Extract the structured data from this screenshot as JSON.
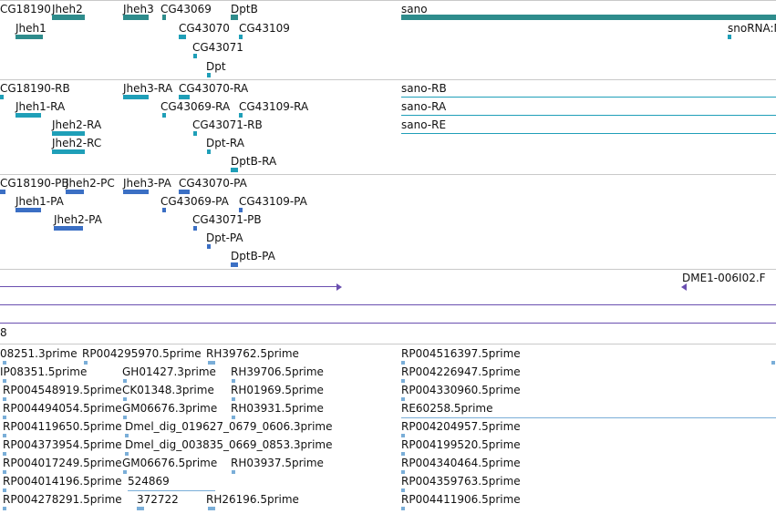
{
  "tracks": {
    "genes": {
      "features": [
        "CG18190",
        "Jheh2",
        "Jheh3",
        "CG43069",
        "DptB",
        "sano",
        "Jheh1",
        "CG43070",
        "CG43109",
        "CG43071",
        "Dpt",
        "snoRNA:M"
      ],
      "color": "#2e8c8c"
    },
    "transcripts": {
      "features": [
        "CG18190-RB",
        "Jheh3-RA",
        "CG43070-RA",
        "sano-RB",
        "Jheh1-RA",
        "CG43069-RA",
        "CG43109-RA",
        "sano-RA",
        "Jheh2-RA",
        "CG43071-RB",
        "sano-RE",
        "Jheh2-RC",
        "Dpt-RA",
        "DptB-RA"
      ],
      "color": "#1f9fb8"
    },
    "proteins": {
      "features": [
        "CG18190-PB",
        "Jheh2-PC",
        "Jheh3-PA",
        "CG43070-PA",
        "Jheh1-PA",
        "CG43069-PA",
        "CG43109-PA",
        "Jheh2-PA",
        "CG43071-PB",
        "Dpt-PA",
        "DptB-PA"
      ],
      "color": "#3b6fc4"
    },
    "alignment": {
      "label": "DME1-006I02.F",
      "color": "#6a4fb0"
    },
    "scaffold": {
      "label": "8"
    },
    "est": {
      "features": [
        "08251.3prime",
        "RP004295970.5prime",
        "RH39762.5prime",
        "RP004516397.5prime",
        "IP08351.5prime",
        "GH01427.3prime",
        "RH39706.5prime",
        "RP004226947.5prime",
        "RP004548919.5prime",
        "CK01348.3prime",
        "RH01969.5prime",
        "RP004330960.5prime",
        "RP004494054.5prime",
        "GM06676.3prime",
        "RH03931.5prime",
        "RE60258.5prime",
        "RP004119650.5prime",
        "Dmel_dig_019627_0679_0606.3prime",
        "RP004204957.5prime",
        "RP004373954.5prime",
        "Dmel_dig_003835_0669_0853.3prime",
        "RP004199520.5prime",
        "RP004017249.5prime",
        "GM06676.5prime",
        "RH03937.5prime",
        "RP004340464.5prime",
        "RP004014196.5prime",
        "524869",
        "RP004359763.5prime",
        "RP004278291.5prime",
        "372722",
        "RH26196.5prime",
        "RP004411906.5prime"
      ],
      "color": "#7aaed8"
    }
  }
}
